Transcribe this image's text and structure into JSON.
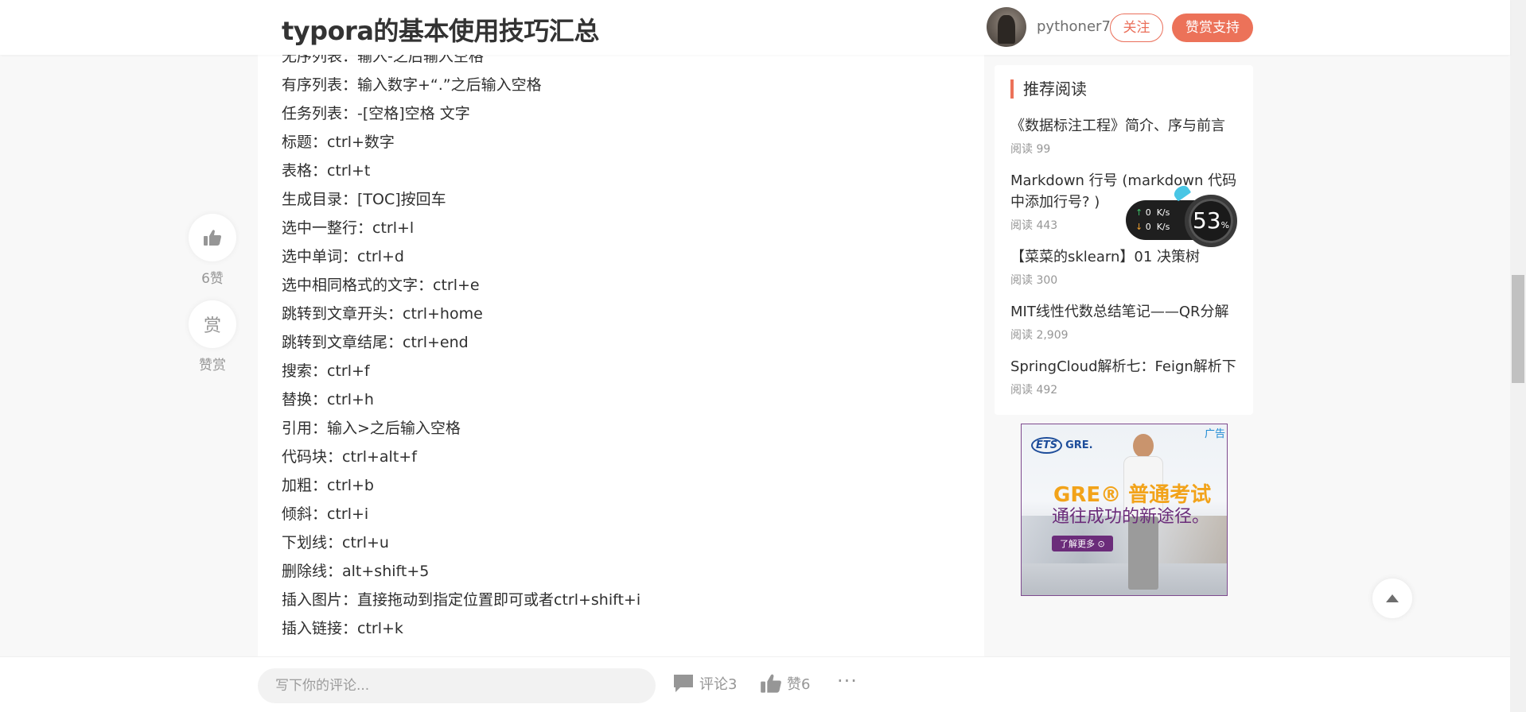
{
  "header": {
    "title": "typora的基本使用技巧汇总",
    "username": "pythoner7",
    "follow_label": "关注",
    "reward_label": "赞赏支持"
  },
  "article": {
    "lines": [
      "无序列表：输入-之后输入空格",
      "有序列表：输入数字+“.”之后输入空格",
      "任务列表：-[空格]空格 文字",
      "标题：ctrl+数字",
      "表格：ctrl+t",
      "生成目录：[TOC]按回车",
      "选中一整行：ctrl+l",
      "选中单词：ctrl+d",
      "选中相同格式的文字：ctrl+e",
      "跳转到文章开头：ctrl+home",
      "跳转到文章结尾：ctrl+end",
      "搜索：ctrl+f",
      "替换：ctrl+h",
      "引用：输入>之后输入空格",
      "代码块：ctrl+alt+f",
      "加粗：ctrl+b",
      "倾斜：ctrl+i",
      "下划线：ctrl+u",
      "删除线：alt+shift+5",
      "插入图片：直接拖动到指定位置即可或者ctrl+shift+i",
      "插入链接：ctrl+k"
    ]
  },
  "left_float": {
    "like_count_label": "6赞",
    "reward_char": "赏",
    "reward_label": "赞赏"
  },
  "sidebar": {
    "title": "推荐阅读",
    "items": [
      {
        "title": "《数据标注工程》简介、序与前言",
        "reads": "阅读 99"
      },
      {
        "title": "Markdown 行号 (markdown 代码 中添加行号? )",
        "reads": "阅读 443"
      },
      {
        "title": "【菜菜的sklearn】01 决策树",
        "reads": "阅读 300"
      },
      {
        "title": "MIT线性代数总结笔记——QR分解",
        "reads": "阅读 2,909"
      },
      {
        "title": "SpringCloud解析七：Feign解析下",
        "reads": "阅读 492"
      }
    ]
  },
  "speed_widget": {
    "up_value": "0",
    "down_value": "0",
    "unit": "K/s",
    "percent": "53",
    "percent_sign": "%"
  },
  "ad": {
    "tag": "广告",
    "logo_ets": "ETS",
    "logo_gre": "GRE.",
    "headline": "GRE® 普通考试",
    "subline": "通往成功的新途径。",
    "more_label": "了解更多 ⊙"
  },
  "bottom": {
    "comment_placeholder": "写下你的评论...",
    "comments_label": "评论3",
    "likes_label": "赞6",
    "more_label": "···"
  },
  "colors": {
    "accent": "#ec7259",
    "text": "#2f2f2f",
    "muted": "#969696"
  },
  "icons": [
    "thumbs-up-icon",
    "comment-icon",
    "arrow-up-icon",
    "more-icon"
  ]
}
